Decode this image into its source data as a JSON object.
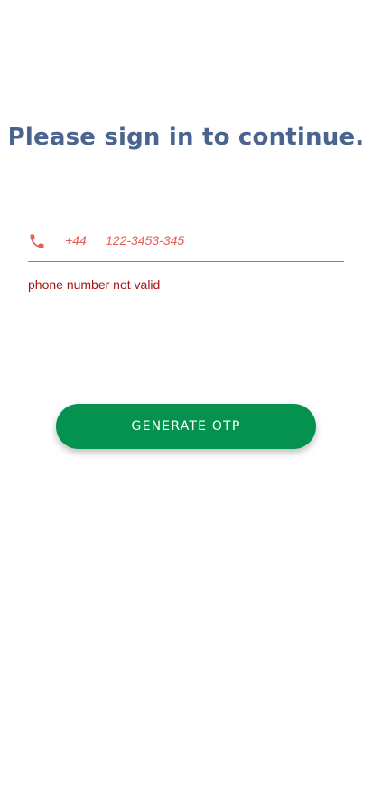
{
  "header": {
    "title": "Please sign in to continue."
  },
  "phone_field": {
    "icon": "phone-icon",
    "country_code": "+44",
    "value": "122-3453-345",
    "error": "phone number not valid"
  },
  "actions": {
    "generate_otp_label": "GENERATE OTP"
  },
  "colors": {
    "title": "#4a6490",
    "error_accent": "#e0605a",
    "error_text": "#a31515",
    "button": "#05924f"
  }
}
